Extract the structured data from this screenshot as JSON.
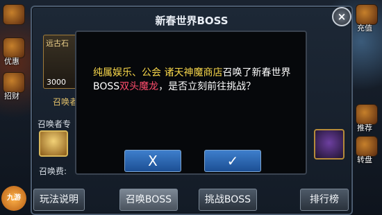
{
  "panel": {
    "title": "新春世界BOSS",
    "close_icon": "×"
  },
  "side": {
    "left_labels": [
      "优惠",
      "招财"
    ],
    "right_labels": [
      "充值",
      "推荐",
      "转盘"
    ]
  },
  "item": {
    "name": "远古石",
    "price": "3000"
  },
  "summon": {
    "header": "召唤者",
    "summoner_label": "召唤者专",
    "fee_label": "召唤费:"
  },
  "dialog": {
    "part1_yellow": "纯属娱乐、公会 诸天神魔商店",
    "part2": "召唤了新春世界BOSS",
    "part3_red": "双头魔龙",
    "part4": "，是否立刻前往挑战？",
    "cancel_symbol": "X",
    "confirm_symbol": "✓"
  },
  "bottom": {
    "rules_label": "玩法说明",
    "summon_label": "召唤BOSS",
    "challenge_label": "挑战BOSS",
    "rank_label": "排行榜"
  },
  "logo": {
    "text": "九游"
  }
}
